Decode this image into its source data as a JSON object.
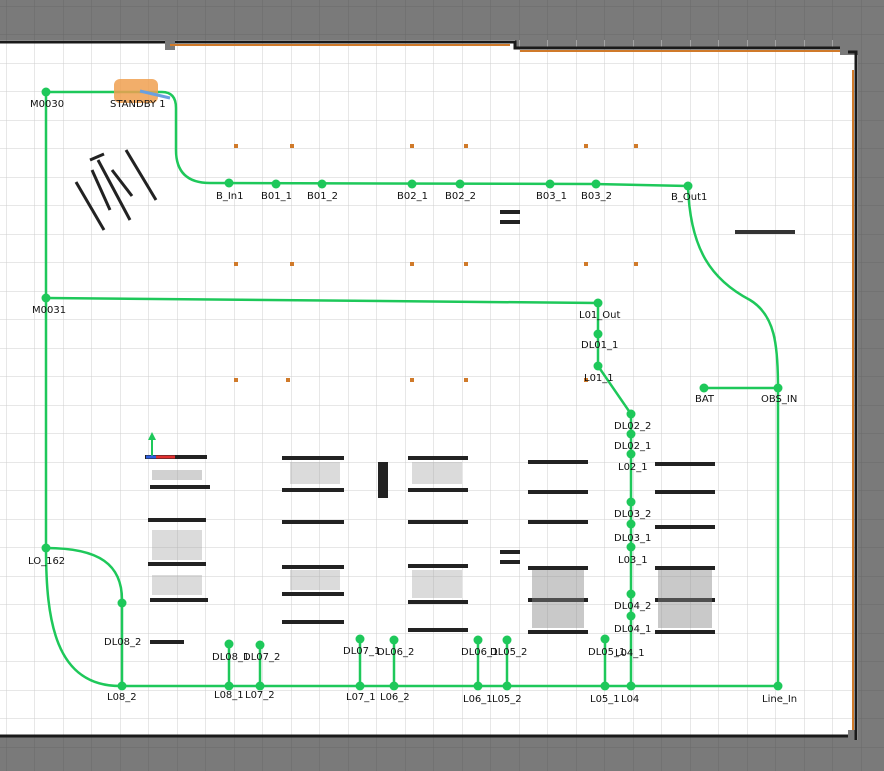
{
  "colors": {
    "outer": "#7a7a7a",
    "floor": "#ffffff",
    "grid": "#cfcfcf",
    "wall": "#1a1a1a",
    "route": "#1ec85a",
    "standby": "#f0a050",
    "dots": "#d07a2a"
  },
  "nodes": [
    {
      "id": "M0030",
      "label": "M0030"
    },
    {
      "id": "STANDBY1",
      "label": "STANDBY 1"
    },
    {
      "id": "B_In1",
      "label": "B_In1"
    },
    {
      "id": "B01_1",
      "label": "B01_1"
    },
    {
      "id": "B01_2",
      "label": "B01_2"
    },
    {
      "id": "B02_1",
      "label": "B02_1"
    },
    {
      "id": "B02_2",
      "label": "B02_2"
    },
    {
      "id": "B03_1",
      "label": "B03_1"
    },
    {
      "id": "B03_2",
      "label": "B03_2"
    },
    {
      "id": "B_Out1",
      "label": "B_Out1"
    },
    {
      "id": "M0031",
      "label": "M0031"
    },
    {
      "id": "L01_Out",
      "label": "L01_Out"
    },
    {
      "id": "DL01_1",
      "label": "DL01_1"
    },
    {
      "id": "L01_1",
      "label": "L01_1"
    },
    {
      "id": "DL02_2",
      "label": "DL02_2"
    },
    {
      "id": "DL02_1",
      "label": "DL02_1"
    },
    {
      "id": "L02_1",
      "label": "L02_1"
    },
    {
      "id": "DL03_2",
      "label": "DL03_2"
    },
    {
      "id": "DL03_1",
      "label": "DL03_1"
    },
    {
      "id": "L03_1",
      "label": "L03_1"
    },
    {
      "id": "DL04_2",
      "label": "DL04_2"
    },
    {
      "id": "DL04_1",
      "label": "DL04_1"
    },
    {
      "id": "BAT",
      "label": "BAT"
    },
    {
      "id": "OBS_IN",
      "label": "OBS_IN"
    },
    {
      "id": "LO_162",
      "label": "LO_162"
    },
    {
      "id": "DL08_2",
      "label": "DL08_2"
    },
    {
      "id": "L08_2",
      "label": "L08_2"
    },
    {
      "id": "DL08_1",
      "label": "DL08_1"
    },
    {
      "id": "DL07_2",
      "label": "DL07_2"
    },
    {
      "id": "L08_1",
      "label": "L08_1"
    },
    {
      "id": "L07_2",
      "label": "L07_2"
    },
    {
      "id": "DL07_1",
      "label": "DL07_1"
    },
    {
      "id": "DL06_2",
      "label": "DL06_2"
    },
    {
      "id": "L07_1",
      "label": "L07_1"
    },
    {
      "id": "L06_2",
      "label": "L06_2"
    },
    {
      "id": "DL06_1",
      "label": "DL06_1"
    },
    {
      "id": "DL05_2",
      "label": "DL05_2"
    },
    {
      "id": "L06_1",
      "label": "L06_1"
    },
    {
      "id": "L05_2",
      "label": "L05_2"
    },
    {
      "id": "DL05_1",
      "label": "DL05_1"
    },
    {
      "id": "L04_1",
      "label": "L04_1"
    },
    {
      "id": "L05_1",
      "label": "L05_1"
    },
    {
      "id": "L04",
      "label": "L04"
    },
    {
      "id": "Line_In",
      "label": "Line_In"
    }
  ]
}
